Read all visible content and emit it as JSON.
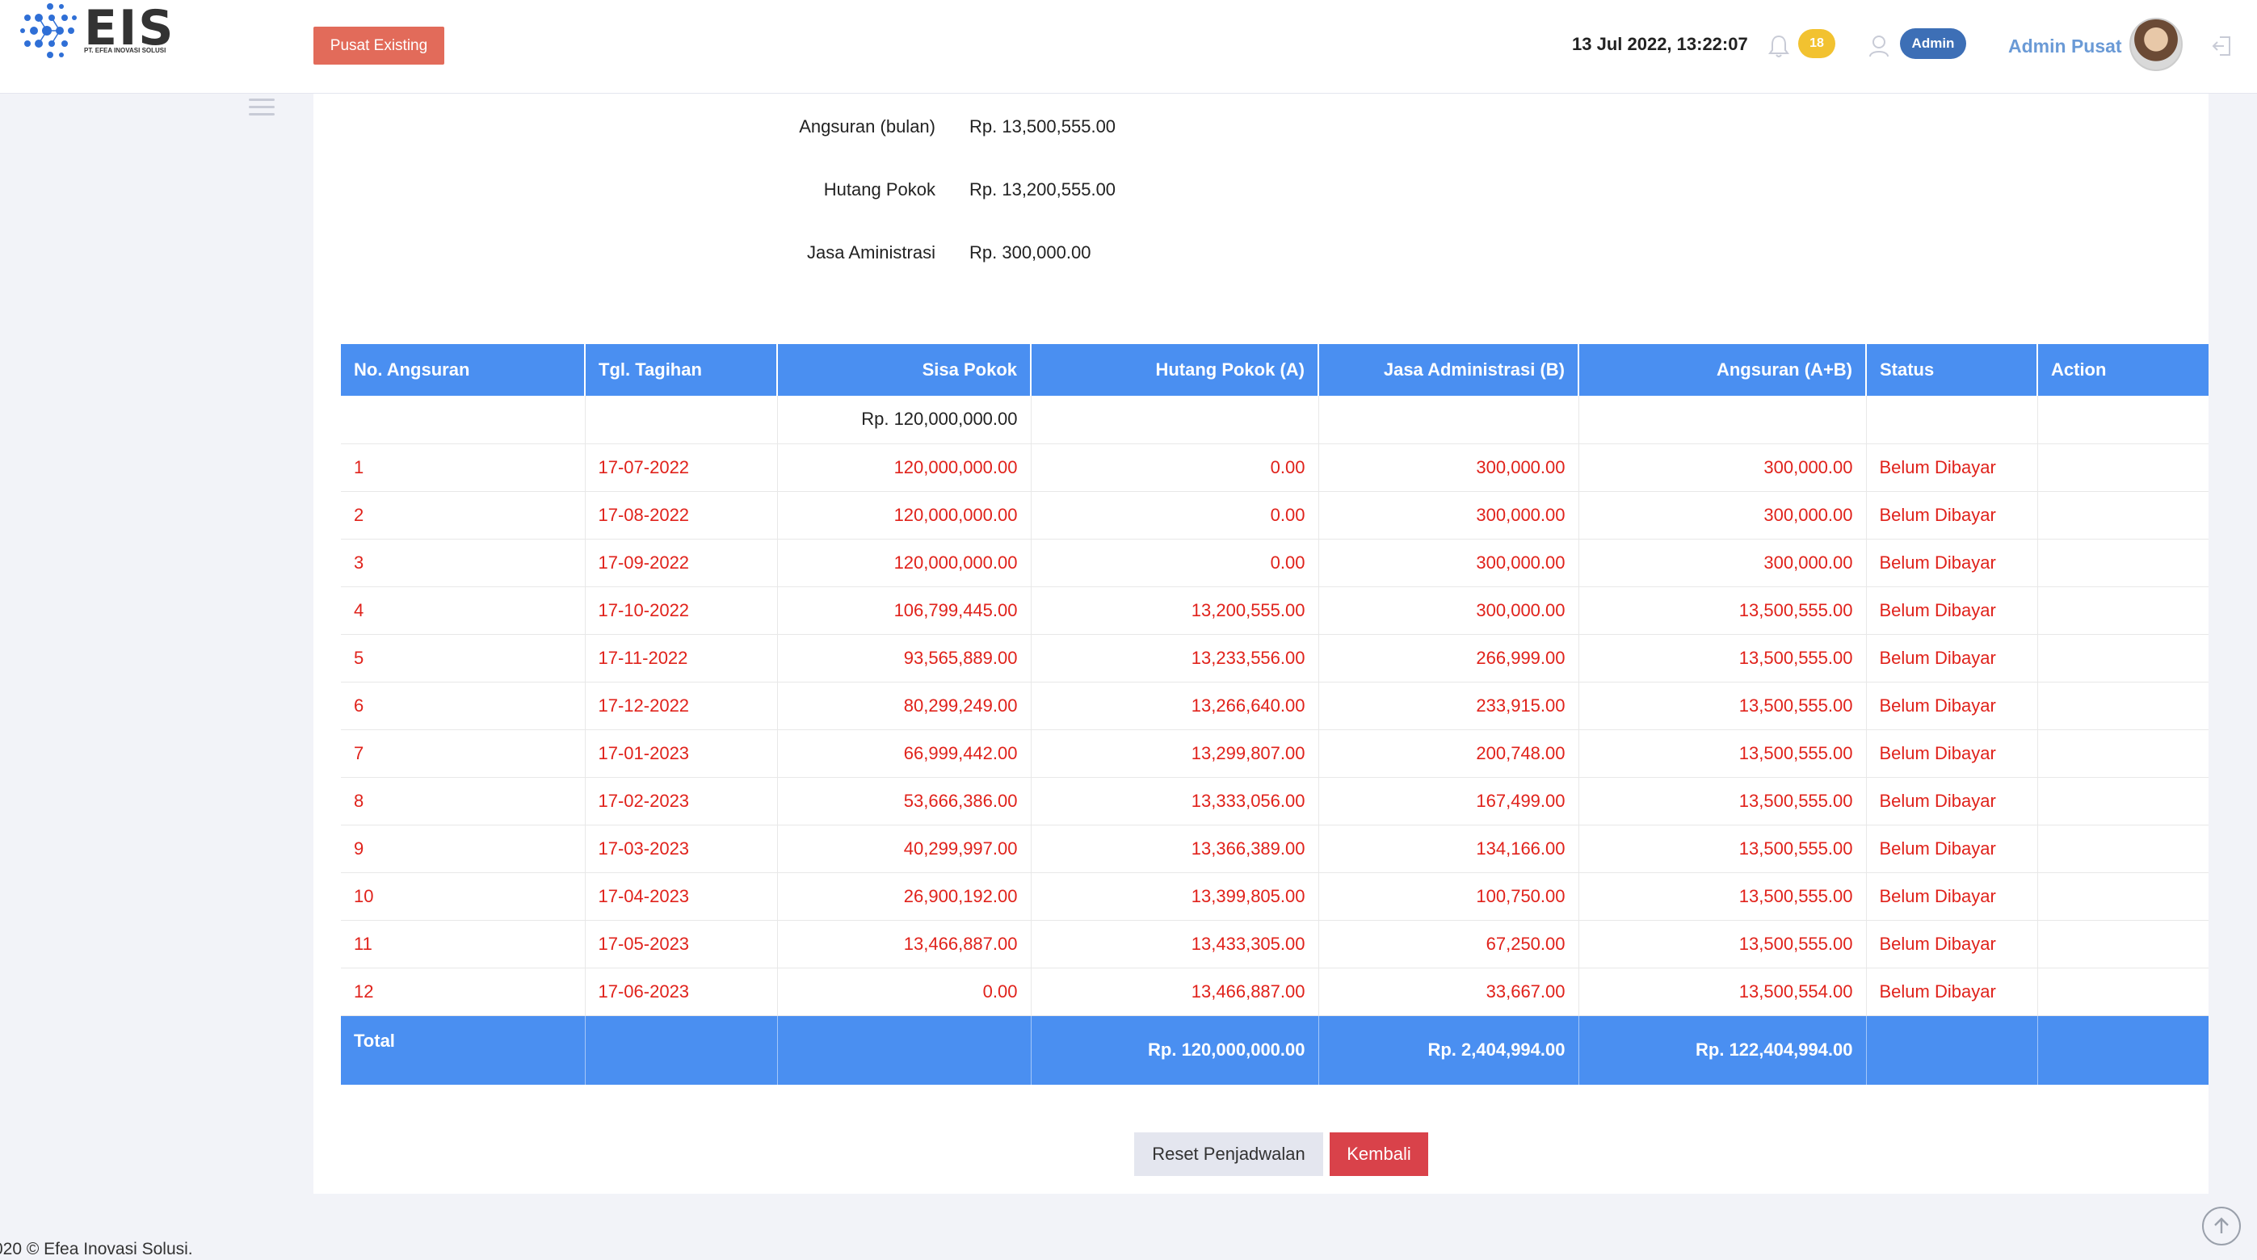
{
  "brand": {
    "name": "EIS",
    "subtitle": "PT. EFEA INOVASI SOLUSI"
  },
  "header": {
    "branch_button": "Pusat Existing",
    "datetime": "13 Jul 2022, 13:22:07",
    "notification_count": "18",
    "role": "Admin",
    "username": "Admin Pusat"
  },
  "summary": [
    {
      "label": "Angsuran (bulan)",
      "value": "Rp. 13,500,555.00"
    },
    {
      "label": "Hutang Pokok",
      "value": "Rp. 13,200,555.00"
    },
    {
      "label": "Jasa Aministrasi",
      "value": "Rp. 300,000.00"
    }
  ],
  "table": {
    "headers": [
      "No. Angsuran",
      "Tgl. Tagihan",
      "Sisa Pokok",
      "Hutang Pokok (A)",
      "Jasa Administrasi (B)",
      "Angsuran (A+B)",
      "Status",
      "Action"
    ],
    "opening_balance": "Rp. 120,000,000.00",
    "rows": [
      [
        "1",
        "17-07-2022",
        "120,000,000.00",
        "0.00",
        "300,000.00",
        "300,000.00",
        "Belum Dibayar"
      ],
      [
        "2",
        "17-08-2022",
        "120,000,000.00",
        "0.00",
        "300,000.00",
        "300,000.00",
        "Belum Dibayar"
      ],
      [
        "3",
        "17-09-2022",
        "120,000,000.00",
        "0.00",
        "300,000.00",
        "300,000.00",
        "Belum Dibayar"
      ],
      [
        "4",
        "17-10-2022",
        "106,799,445.00",
        "13,200,555.00",
        "300,000.00",
        "13,500,555.00",
        "Belum Dibayar"
      ],
      [
        "5",
        "17-11-2022",
        "93,565,889.00",
        "13,233,556.00",
        "266,999.00",
        "13,500,555.00",
        "Belum Dibayar"
      ],
      [
        "6",
        "17-12-2022",
        "80,299,249.00",
        "13,266,640.00",
        "233,915.00",
        "13,500,555.00",
        "Belum Dibayar"
      ],
      [
        "7",
        "17-01-2023",
        "66,999,442.00",
        "13,299,807.00",
        "200,748.00",
        "13,500,555.00",
        "Belum Dibayar"
      ],
      [
        "8",
        "17-02-2023",
        "53,666,386.00",
        "13,333,056.00",
        "167,499.00",
        "13,500,555.00",
        "Belum Dibayar"
      ],
      [
        "9",
        "17-03-2023",
        "40,299,997.00",
        "13,366,389.00",
        "134,166.00",
        "13,500,555.00",
        "Belum Dibayar"
      ],
      [
        "10",
        "17-04-2023",
        "26,900,192.00",
        "13,399,805.00",
        "100,750.00",
        "13,500,555.00",
        "Belum Dibayar"
      ],
      [
        "11",
        "17-05-2023",
        "13,466,887.00",
        "13,433,305.00",
        "67,250.00",
        "13,500,555.00",
        "Belum Dibayar"
      ],
      [
        "12",
        "17-06-2023",
        "0.00",
        "13,466,887.00",
        "33,667.00",
        "13,500,554.00",
        "Belum Dibayar"
      ]
    ],
    "total_label": "Total",
    "total_hutang_pokok": "Rp. 120,000,000.00",
    "total_jasa": "Rp. 2,404,994.00",
    "total_angsuran": "Rp. 122,404,994.00"
  },
  "actions": {
    "reset": "Reset Penjadwalan",
    "back": "Kembali"
  },
  "footer": {
    "copyright": "020 © Efea Inovasi Solusi."
  },
  "colors": {
    "primary": "#4a8ff1",
    "danger_text": "#e0221b",
    "branch_button": "#e26b5a",
    "back_button": "#d9424a"
  }
}
